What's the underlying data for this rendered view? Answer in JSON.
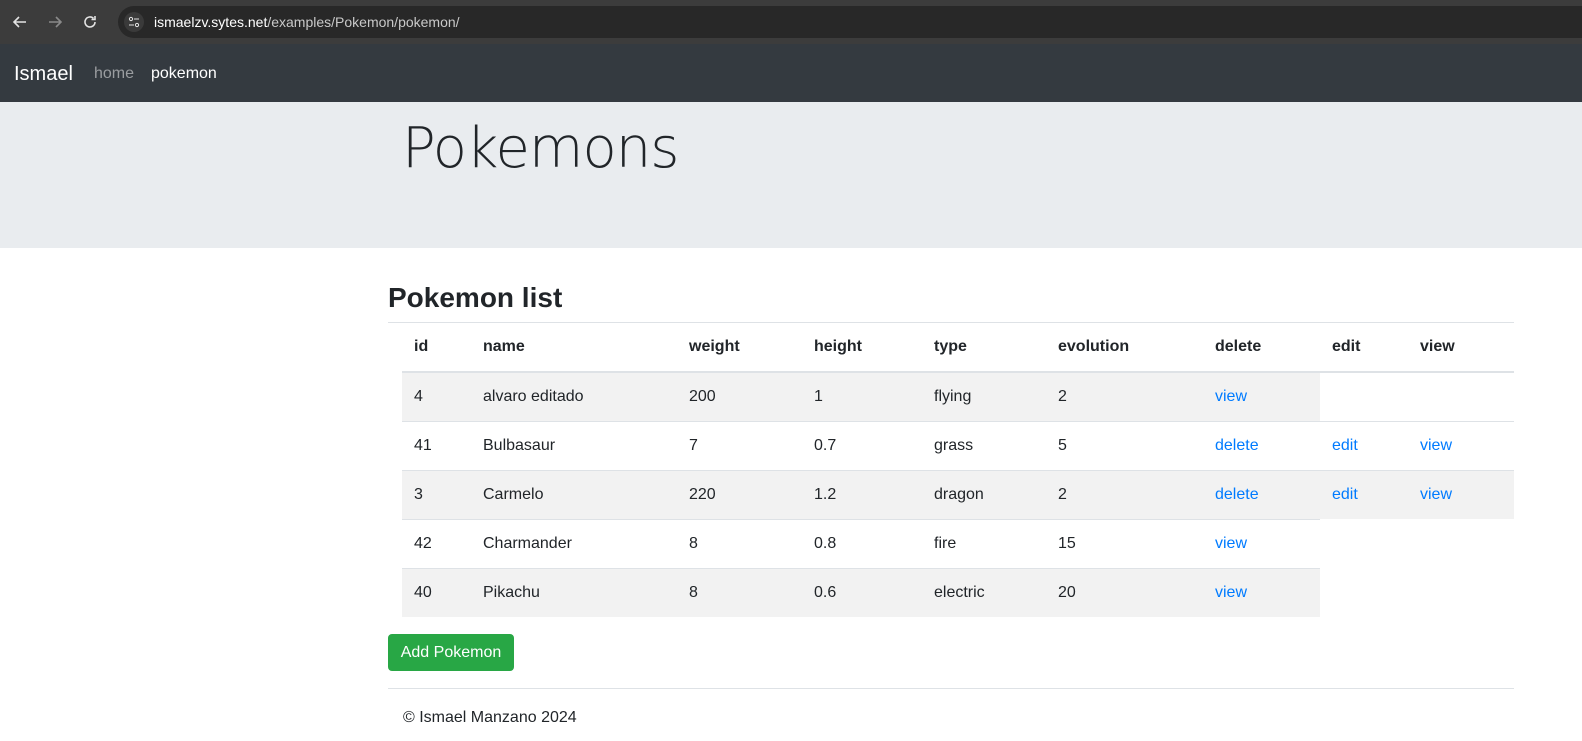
{
  "browser": {
    "url_host": "ismaelzv.sytes.net",
    "url_path": "/examples/Pokemon/pokemon/"
  },
  "navbar": {
    "brand": "Ismael",
    "links": [
      {
        "label": "home"
      },
      {
        "label": "pokemon"
      }
    ]
  },
  "jumbotron": {
    "title": "Pokemons"
  },
  "list": {
    "title": "Pokemon list",
    "columns": [
      "id",
      "name",
      "weight",
      "height",
      "type",
      "evolution",
      "delete",
      "edit",
      "view"
    ],
    "rows": [
      {
        "id": "4",
        "name": "alvaro editado",
        "weight": "200",
        "height": "1",
        "type": "flying",
        "evolution": "2",
        "actions": [
          "view"
        ]
      },
      {
        "id": "41",
        "name": "Bulbasaur",
        "weight": "7",
        "height": "0.7",
        "type": "grass",
        "evolution": "5",
        "actions": [
          "delete",
          "edit",
          "view"
        ]
      },
      {
        "id": "3",
        "name": "Carmelo",
        "weight": "220",
        "height": "1.2",
        "type": "dragon",
        "evolution": "2",
        "actions": [
          "delete",
          "edit",
          "view"
        ]
      },
      {
        "id": "42",
        "name": "Charmander",
        "weight": "8",
        "height": "0.8",
        "type": "fire",
        "evolution": "15",
        "actions": [
          "view"
        ]
      },
      {
        "id": "40",
        "name": "Pikachu",
        "weight": "8",
        "height": "0.6",
        "type": "electric",
        "evolution": "20",
        "actions": [
          "view"
        ]
      }
    ],
    "add_button": "Add Pokemon"
  },
  "footer": {
    "text": "© Ismael Manzano 2024"
  },
  "colors": {
    "navbar_bg": "#343a40",
    "jumbotron_bg": "#e9ecef",
    "link": "#007bff",
    "success": "#28a745",
    "stripe": "#f2f2f2"
  }
}
